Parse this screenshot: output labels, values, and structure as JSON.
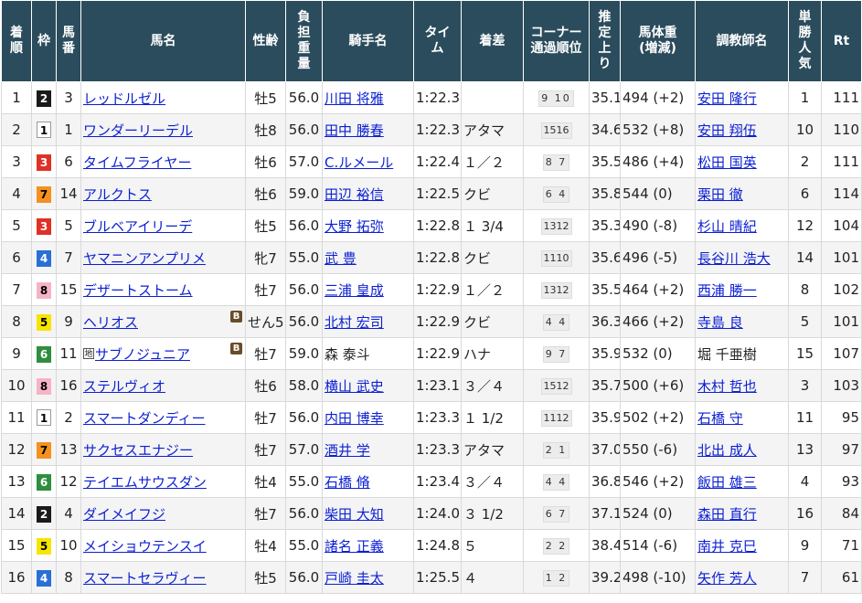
{
  "headers": [
    {
      "key": "rank",
      "label": "着順"
    },
    {
      "key": "waku",
      "label": "枠"
    },
    {
      "key": "umaban",
      "label": "馬番"
    },
    {
      "key": "horse",
      "label": "馬名"
    },
    {
      "key": "sexage",
      "label": "性齢"
    },
    {
      "key": "weight",
      "label": "負担重量"
    },
    {
      "key": "jockey",
      "label": "騎手名"
    },
    {
      "key": "time",
      "label": "タイム"
    },
    {
      "key": "margin",
      "label": "着差"
    },
    {
      "key": "corner",
      "label": "コーナー通過順位"
    },
    {
      "key": "last3f",
      "label": "推定上り"
    },
    {
      "key": "body",
      "label": "馬体重(増減)"
    },
    {
      "key": "trainer",
      "label": "調教師名"
    },
    {
      "key": "pop",
      "label": "単勝人気"
    },
    {
      "key": "rt",
      "label": "Rt"
    }
  ],
  "rows": [
    {
      "rank": "1",
      "waku": "2",
      "umaban": "3",
      "horse": "レッドルゼル",
      "blinker": false,
      "chihou": false,
      "sexage": "牡5",
      "weight": "56.0",
      "jockey": "川田 将雅",
      "jockey_link": true,
      "time": "1:22.3",
      "margin": "",
      "corner": "9 10",
      "last3f": "35.1",
      "body": "494 (+2)",
      "trainer": "安田 隆行",
      "trainer_link": true,
      "pop": "1",
      "rt": "111"
    },
    {
      "rank": "2",
      "waku": "1",
      "umaban": "1",
      "horse": "ワンダーリーデル",
      "blinker": false,
      "chihou": false,
      "sexage": "牡8",
      "weight": "56.0",
      "jockey": "田中 勝春",
      "jockey_link": true,
      "time": "1:22.3",
      "margin": "アタマ",
      "corner": "1516",
      "last3f": "34.6",
      "body": "532 (+8)",
      "trainer": "安田 翔伍",
      "trainer_link": true,
      "pop": "10",
      "rt": "110"
    },
    {
      "rank": "3",
      "waku": "3",
      "umaban": "6",
      "horse": "タイムフライヤー",
      "blinker": false,
      "chihou": false,
      "sexage": "牡6",
      "weight": "57.0",
      "jockey": "C.ルメール",
      "jockey_link": true,
      "time": "1:22.4",
      "margin": "１／２",
      "corner": "8 7",
      "last3f": "35.5",
      "body": "486 (+4)",
      "trainer": "松田 国英",
      "trainer_link": true,
      "pop": "2",
      "rt": "111"
    },
    {
      "rank": "4",
      "waku": "7",
      "umaban": "14",
      "horse": "アルクトス",
      "blinker": false,
      "chihou": false,
      "sexage": "牡6",
      "weight": "59.0",
      "jockey": "田辺 裕信",
      "jockey_link": true,
      "time": "1:22.5",
      "margin": "クビ",
      "corner": "6 4",
      "last3f": "35.8",
      "body": "544 (0)",
      "trainer": "栗田 徹",
      "trainer_link": true,
      "pop": "6",
      "rt": "114"
    },
    {
      "rank": "5",
      "waku": "3",
      "umaban": "5",
      "horse": "ブルベアイリーデ",
      "blinker": false,
      "chihou": false,
      "sexage": "牡5",
      "weight": "56.0",
      "jockey": "大野 拓弥",
      "jockey_link": true,
      "time": "1:22.8",
      "margin": "１ 3/4",
      "corner": "1312",
      "last3f": "35.3",
      "body": "490 (-8)",
      "trainer": "杉山 晴紀",
      "trainer_link": true,
      "pop": "12",
      "rt": "104"
    },
    {
      "rank": "6",
      "waku": "4",
      "umaban": "7",
      "horse": "ヤマニンアンプリメ",
      "blinker": false,
      "chihou": false,
      "sexage": "牝7",
      "weight": "55.0",
      "jockey": "武 豊",
      "jockey_link": true,
      "time": "1:22.8",
      "margin": "クビ",
      "corner": "1110",
      "last3f": "35.6",
      "body": "496 (-5)",
      "trainer": "長谷川 浩大",
      "trainer_link": true,
      "pop": "14",
      "rt": "101"
    },
    {
      "rank": "7",
      "waku": "8",
      "umaban": "15",
      "horse": "デザートストーム",
      "blinker": false,
      "chihou": false,
      "sexage": "牡7",
      "weight": "56.0",
      "jockey": "三浦 皇成",
      "jockey_link": true,
      "time": "1:22.9",
      "margin": "１／２",
      "corner": "1312",
      "last3f": "35.5",
      "body": "464 (+2)",
      "trainer": "西浦 勝一",
      "trainer_link": true,
      "pop": "8",
      "rt": "102"
    },
    {
      "rank": "8",
      "waku": "5",
      "umaban": "9",
      "horse": "ヘリオス",
      "blinker": true,
      "chihou": false,
      "sexage": "せん5",
      "weight": "56.0",
      "jockey": "北村 宏司",
      "jockey_link": true,
      "time": "1:22.9",
      "margin": "クビ",
      "corner": "4 4",
      "last3f": "36.3",
      "body": "466 (+2)",
      "trainer": "寺島 良",
      "trainer_link": true,
      "pop": "5",
      "rt": "101"
    },
    {
      "rank": "9",
      "waku": "6",
      "umaban": "11",
      "horse": "サブノジュニア",
      "blinker": true,
      "chihou": true,
      "chihou_label": "地",
      "sexage": "牡7",
      "weight": "59.0",
      "jockey": "森 泰斗",
      "jockey_link": false,
      "time": "1:22.9",
      "margin": "ハナ",
      "corner": "9 7",
      "last3f": "35.9",
      "body": "532 (0)",
      "trainer": "堀 千亜樹",
      "trainer_link": false,
      "pop": "15",
      "rt": "107"
    },
    {
      "rank": "10",
      "waku": "8",
      "umaban": "16",
      "horse": "ステルヴィオ",
      "blinker": false,
      "chihou": false,
      "sexage": "牡6",
      "weight": "58.0",
      "jockey": "横山 武史",
      "jockey_link": true,
      "time": "1:23.1",
      "margin": "３／４",
      "corner": "1512",
      "last3f": "35.7",
      "body": "500 (+6)",
      "trainer": "木村 哲也",
      "trainer_link": true,
      "pop": "3",
      "rt": "103"
    },
    {
      "rank": "11",
      "waku": "1",
      "umaban": "2",
      "horse": "スマートダンディー",
      "blinker": false,
      "chihou": false,
      "sexage": "牡7",
      "weight": "56.0",
      "jockey": "内田 博幸",
      "jockey_link": true,
      "time": "1:23.3",
      "margin": "１ 1/2",
      "corner": "1112",
      "last3f": "35.9",
      "body": "502 (+2)",
      "trainer": "石橋 守",
      "trainer_link": true,
      "pop": "11",
      "rt": "95"
    },
    {
      "rank": "12",
      "waku": "7",
      "umaban": "13",
      "horse": "サクセスエナジー",
      "blinker": false,
      "chihou": false,
      "sexage": "牡7",
      "weight": "57.0",
      "jockey": "酒井 学",
      "jockey_link": true,
      "time": "1:23.3",
      "margin": "アタマ",
      "corner": "2 1",
      "last3f": "37.0",
      "body": "550 (-6)",
      "trainer": "北出 成人",
      "trainer_link": true,
      "pop": "13",
      "rt": "97"
    },
    {
      "rank": "13",
      "waku": "6",
      "umaban": "12",
      "horse": "テイエムサウスダン",
      "blinker": false,
      "chihou": false,
      "sexage": "牡4",
      "weight": "55.0",
      "jockey": "石橋 脩",
      "jockey_link": true,
      "time": "1:23.4",
      "margin": "３／４",
      "corner": "4 4",
      "last3f": "36.8",
      "body": "546 (+2)",
      "trainer": "飯田 雄三",
      "trainer_link": true,
      "pop": "4",
      "rt": "93"
    },
    {
      "rank": "14",
      "waku": "2",
      "umaban": "4",
      "horse": "ダイメイフジ",
      "blinker": false,
      "chihou": false,
      "sexage": "牡7",
      "weight": "56.0",
      "jockey": "柴田 大知",
      "jockey_link": true,
      "time": "1:24.0",
      "margin": "３ 1/2",
      "corner": "6 7",
      "last3f": "37.1",
      "body": "524 (0)",
      "trainer": "森田 直行",
      "trainer_link": true,
      "pop": "16",
      "rt": "84"
    },
    {
      "rank": "15",
      "waku": "5",
      "umaban": "10",
      "horse": "メイショウテンスイ",
      "blinker": false,
      "chihou": false,
      "sexage": "牡4",
      "weight": "55.0",
      "jockey": "諸名 正義",
      "jockey_link": true,
      "time": "1:24.8",
      "margin": "５",
      "corner": "2 2",
      "last3f": "38.4",
      "body": "514 (-6)",
      "trainer": "南井 克巳",
      "trainer_link": true,
      "pop": "9",
      "rt": "71"
    },
    {
      "rank": "16",
      "waku": "4",
      "umaban": "8",
      "horse": "スマートセラヴィー",
      "blinker": false,
      "chihou": false,
      "sexage": "牡5",
      "weight": "56.0",
      "jockey": "戸崎 圭太",
      "jockey_link": true,
      "time": "1:25.5",
      "margin": "４",
      "corner": "1 2",
      "last3f": "39.2",
      "body": "498 (-10)",
      "trainer": "矢作 芳人",
      "trainer_link": true,
      "pop": "7",
      "rt": "61"
    }
  ],
  "blinker_label": "B"
}
